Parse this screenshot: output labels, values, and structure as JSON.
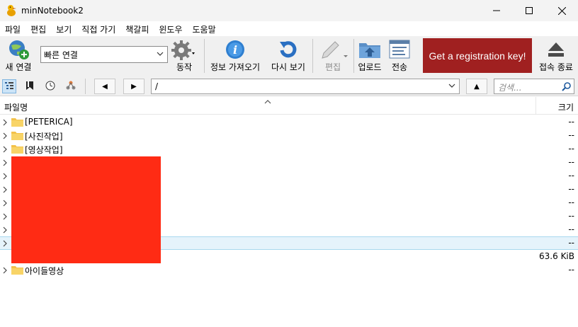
{
  "window": {
    "title": "minNotebook2"
  },
  "menu": [
    "파일",
    "편집",
    "보기",
    "직접 가기",
    "책갈피",
    "윈도우",
    "도움말"
  ],
  "toolbar": {
    "new_connection": "새 연결",
    "quick_connect_value": "빠른 연결",
    "action": "동작",
    "get_info": "정보 가져오기",
    "refresh": "다시 보기",
    "edit": "편집",
    "upload": "업로드",
    "transfers": "전송",
    "registration": "Get a registration key!",
    "disconnect": "접속 종료"
  },
  "navbar": {
    "back": "◀",
    "forward": "▶",
    "up": "▲",
    "path": "/",
    "search_placeholder": "검색..."
  },
  "columns": {
    "name": "파일명",
    "size": "크기"
  },
  "rows": [
    {
      "name": "[PETERICA]",
      "size": "--",
      "folder": true
    },
    {
      "name": "[사진작업]",
      "size": "--",
      "folder": true
    },
    {
      "name": "[영상작업]",
      "size": "--",
      "folder": true
    },
    {
      "name": "",
      "size": "--",
      "folder": false
    },
    {
      "name": "",
      "size": "--",
      "folder": false
    },
    {
      "name": "",
      "size": "--",
      "folder": false
    },
    {
      "name": "",
      "size": "--",
      "folder": false
    },
    {
      "name": "",
      "size": "--",
      "folder": false
    },
    {
      "name": "",
      "size": "--",
      "folder": false
    },
    {
      "name": "",
      "size": "--",
      "folder": false
    },
    {
      "name": "",
      "size": "63.6 KiB",
      "folder": false
    },
    {
      "name": "아이들영상",
      "size": "--",
      "folder": true
    }
  ],
  "colors": {
    "registration_bg": "#a02020",
    "redaction": "#ff2b14",
    "selection": "#e5f3fb"
  }
}
